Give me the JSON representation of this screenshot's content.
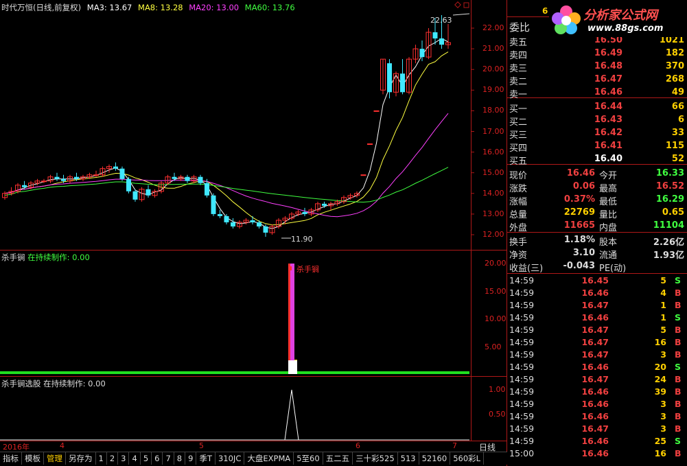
{
  "header": {
    "title": "时代万恒(日线,前复权)",
    "ma3_label": "MA3: 13.67",
    "ma8_label": "MA8: 13.28",
    "ma20_label": "MA20: 13.00",
    "ma60_label": "MA60: 13.76"
  },
  "indicator1": {
    "name": "杀手锏",
    "status": "在持续制作: 0.00",
    "signal_label": "杀手锏",
    "ticks": [
      "20.00",
      "15.00",
      "10.00",
      "5.00"
    ]
  },
  "indicator2": {
    "name": "杀手锏选股",
    "status": "在持续制作: 0.00",
    "ticks": [
      "1.00",
      "0.50"
    ]
  },
  "price_axis": [
    "22.00",
    "21.00",
    "20.00",
    "19.00",
    "18.00",
    "17.00",
    "16.00",
    "15.00",
    "14.00",
    "13.00",
    "12.00"
  ],
  "annotations": {
    "high": "22.63",
    "low": "11.90"
  },
  "date_axis": {
    "year": "2016年",
    "months": [
      "4",
      "5",
      "6",
      "7"
    ],
    "period": "日线"
  },
  "colors": {
    "up": "#ff3030",
    "down": "#40e8ff",
    "ma3": "#ffffff",
    "ma8": "#ffff40",
    "ma20": "#ff40ff",
    "ma60": "#40ff40"
  },
  "logo": {
    "top": "分析家公式网",
    "bottom": "www.88gs.com",
    "prefix": "6"
  },
  "quote": {
    "weibi_label": "委比",
    "asks": [
      {
        "label": "卖五",
        "price": "16.50",
        "vol": "1021"
      },
      {
        "label": "卖四",
        "price": "16.49",
        "vol": "182"
      },
      {
        "label": "卖三",
        "price": "16.48",
        "vol": "370"
      },
      {
        "label": "卖二",
        "price": "16.47",
        "vol": "268"
      },
      {
        "label": "卖一",
        "price": "16.46",
        "vol": "49"
      }
    ],
    "bids": [
      {
        "label": "买一",
        "price": "16.44",
        "vol": "66"
      },
      {
        "label": "买二",
        "price": "16.43",
        "vol": "6"
      },
      {
        "label": "买三",
        "price": "16.42",
        "vol": "33"
      },
      {
        "label": "买四",
        "price": "16.41",
        "vol": "115"
      },
      {
        "label": "买五",
        "price": "16.40",
        "vol": "52"
      }
    ],
    "stats": [
      {
        "k": "现价",
        "a": "16.46",
        "k2": "今开",
        "b": "16.33",
        "ac": "#f04040",
        "bc": "#40ff40"
      },
      {
        "k": "涨跌",
        "a": "0.06",
        "k2": "最高",
        "b": "16.52",
        "ac": "#f04040",
        "bc": "#f04040"
      },
      {
        "k": "涨幅",
        "a": "0.37%",
        "k2": "最低",
        "b": "16.29",
        "ac": "#f04040",
        "bc": "#40ff40"
      },
      {
        "k": "总量",
        "a": "22769",
        "k2": "量比",
        "b": "0.65",
        "ac": "#ffd000",
        "bc": "#ffd000"
      },
      {
        "k": "外盘",
        "a": "11665",
        "k2": "内盘",
        "b": "11104",
        "ac": "#f04040",
        "bc": "#40ff40"
      }
    ],
    "stats2": [
      {
        "k": "换手",
        "a": "1.18%",
        "k2": "股本",
        "b": "2.26亿",
        "ac": "#ddd",
        "bc": "#ddd"
      },
      {
        "k": "净资",
        "a": "3.10",
        "k2": "流通",
        "b": "1.93亿",
        "ac": "#ddd",
        "bc": "#ddd"
      },
      {
        "k": "收益(三)",
        "a": "-0.043",
        "k2": "PE(动)",
        "b": "",
        "ac": "#ddd",
        "bc": "#ddd"
      }
    ]
  },
  "ticks": [
    {
      "t": "14:59",
      "p": "16.45",
      "v": "5",
      "d": "S"
    },
    {
      "t": "14:59",
      "p": "16.46",
      "v": "4",
      "d": "B"
    },
    {
      "t": "14:59",
      "p": "16.47",
      "v": "1",
      "d": "B"
    },
    {
      "t": "14:59",
      "p": "16.46",
      "v": "1",
      "d": "S"
    },
    {
      "t": "14:59",
      "p": "16.47",
      "v": "5",
      "d": "B"
    },
    {
      "t": "14:59",
      "p": "16.47",
      "v": "16",
      "d": "B"
    },
    {
      "t": "14:59",
      "p": "16.47",
      "v": "3",
      "d": "B"
    },
    {
      "t": "14:59",
      "p": "16.46",
      "v": "20",
      "d": "S"
    },
    {
      "t": "14:59",
      "p": "16.47",
      "v": "24",
      "d": "B"
    },
    {
      "t": "14:59",
      "p": "16.46",
      "v": "39",
      "d": "B"
    },
    {
      "t": "14:59",
      "p": "16.46",
      "v": "3",
      "d": "B"
    },
    {
      "t": "14:59",
      "p": "16.46",
      "v": "3",
      "d": "B"
    },
    {
      "t": "14:59",
      "p": "16.47",
      "v": "3",
      "d": "B"
    },
    {
      "t": "14:59",
      "p": "16.46",
      "v": "25",
      "d": "S"
    },
    {
      "t": "15:00",
      "p": "16.46",
      "v": "16",
      "d": "B"
    }
  ],
  "tabs": [
    "指标",
    "模板",
    "管理",
    "另存为",
    "1",
    "2",
    "3",
    "4",
    "5",
    "6",
    "7",
    "8",
    "9",
    "季T",
    "310JC",
    "大盘EXPMA",
    "5至60",
    "五二五",
    "三十彩525",
    "513",
    "52160",
    "560彩L"
  ],
  "chart_data": {
    "type": "candlestick",
    "title": "时代万恒(日线,前复权)",
    "ylim": [
      11.6,
      22.8
    ],
    "x_months": [
      "4",
      "5",
      "6",
      "7"
    ],
    "candles": [
      [
        13.8,
        14.1,
        13.7,
        14.0
      ],
      [
        14.0,
        14.3,
        13.9,
        14.1
      ],
      [
        14.1,
        14.5,
        14.0,
        14.4
      ],
      [
        14.4,
        14.6,
        14.2,
        14.3
      ],
      [
        14.3,
        14.6,
        14.2,
        14.5
      ],
      [
        14.5,
        14.7,
        14.4,
        14.6
      ],
      [
        14.6,
        14.7,
        14.5,
        14.6
      ],
      [
        14.6,
        14.9,
        14.5,
        14.8
      ],
      [
        14.8,
        15.0,
        14.6,
        14.7
      ],
      [
        14.7,
        14.9,
        14.5,
        14.6
      ],
      [
        14.6,
        14.9,
        14.5,
        14.8
      ],
      [
        14.8,
        15.0,
        14.6,
        14.7
      ],
      [
        14.7,
        14.9,
        14.6,
        14.8
      ],
      [
        14.8,
        15.0,
        14.7,
        14.9
      ],
      [
        14.9,
        15.1,
        14.8,
        14.9
      ],
      [
        14.9,
        15.3,
        14.8,
        15.2
      ],
      [
        15.2,
        15.4,
        15.0,
        15.3
      ],
      [
        15.3,
        15.5,
        15.1,
        15.2
      ],
      [
        15.2,
        15.3,
        14.6,
        14.7
      ],
      [
        14.7,
        14.8,
        14.0,
        14.1
      ],
      [
        14.1,
        14.2,
        13.6,
        13.7
      ],
      [
        13.7,
        14.3,
        13.6,
        14.2
      ],
      [
        14.2,
        14.4,
        13.8,
        13.9
      ],
      [
        13.9,
        14.2,
        13.8,
        14.1
      ],
      [
        14.1,
        14.6,
        14.0,
        14.5
      ],
      [
        14.5,
        14.9,
        14.4,
        14.8
      ],
      [
        14.8,
        15.0,
        14.6,
        14.7
      ],
      [
        14.7,
        14.9,
        14.6,
        14.8
      ],
      [
        14.8,
        14.9,
        14.5,
        14.6
      ],
      [
        14.6,
        14.9,
        14.5,
        14.8
      ],
      [
        14.8,
        14.9,
        14.4,
        14.5
      ],
      [
        14.5,
        14.7,
        13.8,
        13.9
      ],
      [
        13.9,
        14.0,
        12.9,
        13.0
      ],
      [
        13.0,
        13.2,
        12.8,
        12.9
      ],
      [
        12.9,
        13.0,
        12.5,
        12.6
      ],
      [
        12.6,
        12.8,
        12.3,
        12.4
      ],
      [
        12.4,
        12.7,
        12.3,
        12.6
      ],
      [
        12.6,
        12.8,
        12.5,
        12.7
      ],
      [
        12.7,
        12.9,
        12.5,
        12.6
      ],
      [
        12.6,
        12.7,
        12.3,
        12.4
      ],
      [
        12.4,
        12.5,
        11.9,
        12.1
      ],
      [
        12.1,
        12.5,
        12.0,
        12.4
      ],
      [
        12.4,
        12.8,
        12.3,
        12.7
      ],
      [
        12.7,
        12.9,
        12.5,
        12.8
      ],
      [
        12.8,
        13.1,
        12.7,
        13.0
      ],
      [
        13.0,
        13.2,
        12.9,
        13.1
      ],
      [
        13.1,
        13.3,
        12.9,
        13.0
      ],
      [
        13.0,
        13.3,
        12.9,
        13.2
      ],
      [
        13.2,
        13.6,
        13.1,
        13.5
      ],
      [
        13.5,
        13.6,
        13.3,
        13.4
      ],
      [
        13.4,
        13.6,
        13.2,
        13.5
      ],
      [
        13.5,
        13.7,
        13.4,
        13.6
      ],
      [
        13.6,
        13.9,
        13.5,
        13.8
      ],
      [
        13.8,
        14.0,
        13.7,
        13.9
      ],
      [
        13.9,
        14.1,
        13.8,
        14.0
      ],
      [
        14.9,
        14.9,
        14.9,
        14.9
      ],
      [
        16.4,
        16.4,
        16.4,
        16.4
      ],
      [
        18.0,
        18.0,
        18.0,
        18.0
      ],
      [
        19.0,
        20.5,
        18.8,
        20.5
      ],
      [
        20.3,
        20.5,
        18.6,
        18.9
      ],
      [
        18.9,
        19.9,
        18.7,
        19.8
      ],
      [
        19.8,
        20.5,
        18.8,
        18.9
      ],
      [
        18.9,
        20.6,
        18.8,
        20.5
      ],
      [
        20.5,
        21.2,
        20.3,
        21.0
      ],
      [
        21.0,
        21.4,
        20.4,
        20.6
      ],
      [
        20.6,
        22.0,
        20.5,
        21.8
      ],
      [
        21.8,
        22.5,
        21.2,
        21.5
      ],
      [
        21.5,
        22.63,
        21.0,
        21.2
      ],
      [
        21.2,
        22.2,
        21.0,
        21.3
      ]
    ],
    "signal": {
      "index": 44,
      "value": 20.0,
      "label": "杀手锏"
    },
    "series": [
      {
        "name": "MA3"
      },
      {
        "name": "MA8"
      },
      {
        "name": "MA20"
      },
      {
        "name": "MA60"
      }
    ]
  }
}
